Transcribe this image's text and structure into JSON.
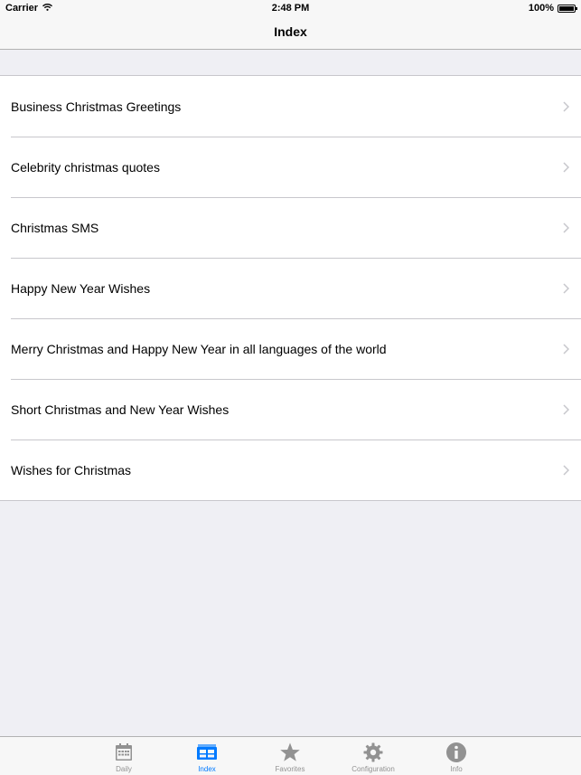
{
  "status_bar": {
    "carrier": "Carrier",
    "time": "2:48 PM",
    "battery": "100%"
  },
  "nav": {
    "title": "Index"
  },
  "list": {
    "items": [
      {
        "label": "Business Christmas Greetings"
      },
      {
        "label": "Celebrity christmas quotes"
      },
      {
        "label": "Christmas SMS"
      },
      {
        "label": "Happy New Year Wishes"
      },
      {
        "label": "Merry Christmas and Happy New Year in all languages of the world"
      },
      {
        "label": "Short Christmas and New Year Wishes"
      },
      {
        "label": "Wishes for Christmas"
      }
    ]
  },
  "tabs": [
    {
      "label": "Daily",
      "icon": "calendar-icon"
    },
    {
      "label": "Index",
      "icon": "index-icon",
      "active": true
    },
    {
      "label": "Favorites",
      "icon": "star-icon"
    },
    {
      "label": "Configuration",
      "icon": "gear-icon"
    },
    {
      "label": "Info",
      "icon": "info-icon"
    }
  ],
  "colors": {
    "accent": "#007aff",
    "inactive_tab": "#929292",
    "background": "#efeff4"
  }
}
